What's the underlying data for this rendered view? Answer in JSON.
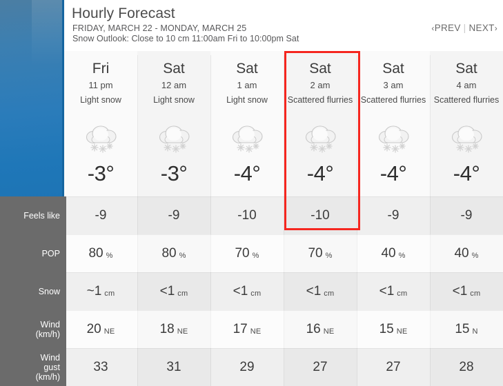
{
  "header": {
    "title": "Hourly Forecast",
    "date_range": "FRIDAY, MARCH 22 - MONDAY, MARCH 25",
    "outlook": "Snow Outlook: Close to 10 cm 11:00am Fri to 10:00pm Sat",
    "prev_label": "PREV",
    "next_label": "NEXT",
    "prev_chevron": "‹",
    "next_chevron": "›",
    "nav_divider": "|"
  },
  "row_labels": {
    "feels_like": "Feels like",
    "pop": "POP",
    "snow": "Snow",
    "wind_line1": "Wind",
    "wind_line2": "(km/h)",
    "wind_gust_line1": "Wind",
    "wind_gust_line2": "gust",
    "wind_gust_line3": "(km/h)"
  },
  "highlight": {
    "color": "#f5261f",
    "column_index": 3
  },
  "columns": [
    {
      "day": "Fri",
      "time": "11 pm",
      "condition": "Light snow",
      "icon": "cloud-snow-icon",
      "temperature": "-3°",
      "feels_like": "-9",
      "pop_value": "80",
      "pop_unit": "%",
      "snow_value": "~1",
      "snow_unit": "cm",
      "wind_value": "20",
      "wind_dir": "NE",
      "wind_gust": "33"
    },
    {
      "day": "Sat",
      "time": "12 am",
      "condition": "Light snow",
      "icon": "cloud-snow-icon",
      "temperature": "-3°",
      "feels_like": "-9",
      "pop_value": "80",
      "pop_unit": "%",
      "snow_value": "<1",
      "snow_unit": "cm",
      "wind_value": "18",
      "wind_dir": "NE",
      "wind_gust": "31"
    },
    {
      "day": "Sat",
      "time": "1 am",
      "condition": "Light snow",
      "icon": "cloud-snow-icon",
      "temperature": "-4°",
      "feels_like": "-10",
      "pop_value": "70",
      "pop_unit": "%",
      "snow_value": "<1",
      "snow_unit": "cm",
      "wind_value": "17",
      "wind_dir": "NE",
      "wind_gust": "29"
    },
    {
      "day": "Sat",
      "time": "2 am",
      "condition": "Scattered flurries",
      "icon": "cloud-snow-icon",
      "temperature": "-4°",
      "feels_like": "-10",
      "pop_value": "70",
      "pop_unit": "%",
      "snow_value": "<1",
      "snow_unit": "cm",
      "wind_value": "16",
      "wind_dir": "NE",
      "wind_gust": "27"
    },
    {
      "day": "Sat",
      "time": "3 am",
      "condition": "Scattered flurries",
      "icon": "cloud-snow-icon",
      "temperature": "-4°",
      "feels_like": "-9",
      "pop_value": "40",
      "pop_unit": "%",
      "snow_value": "<1",
      "snow_unit": "cm",
      "wind_value": "15",
      "wind_dir": "NE",
      "wind_gust": "27"
    },
    {
      "day": "Sat",
      "time": "4 am",
      "condition": "Scattered flurries",
      "icon": "cloud-snow-icon",
      "temperature": "-4°",
      "feels_like": "-9",
      "pop_value": "40",
      "pop_unit": "%",
      "snow_value": "<1",
      "snow_unit": "cm",
      "wind_value": "15",
      "wind_dir": "N",
      "wind_gust": "28"
    }
  ]
}
